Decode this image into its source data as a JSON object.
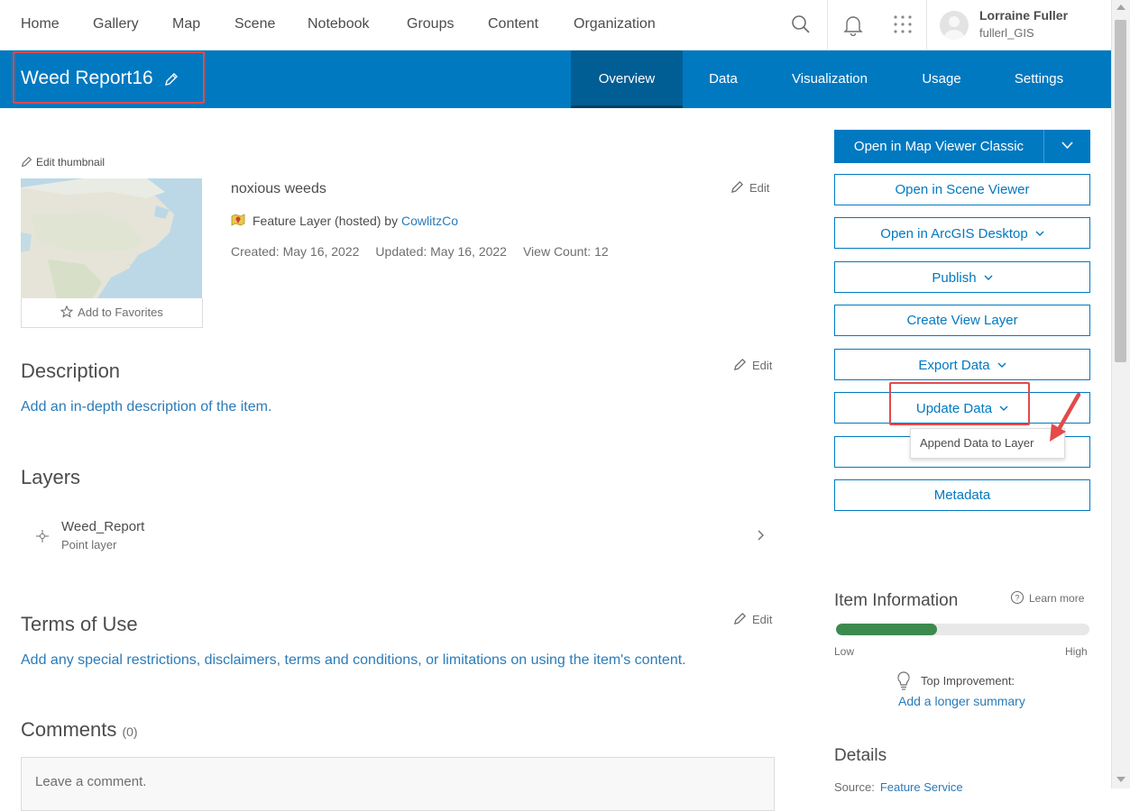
{
  "nav": {
    "items": [
      "Home",
      "Gallery",
      "Map",
      "Scene",
      "Notebook",
      "Groups",
      "Content",
      "Organization"
    ],
    "user_name": "Lorraine Fuller",
    "user_handle": "fullerl_GIS"
  },
  "header": {
    "title": "Weed Report16",
    "tabs": [
      "Overview",
      "Data",
      "Visualization",
      "Usage",
      "Settings"
    ],
    "active_tab": "Overview"
  },
  "overview": {
    "edit_thumbnail": "Edit thumbnail",
    "add_favorites": "Add to Favorites",
    "summary": "noxious weeds",
    "edit_label": "Edit",
    "type_prefix": "Feature Layer (hosted) by",
    "owner": "CowlitzCo",
    "created": "Created: May 16, 2022",
    "updated": "Updated: May 16, 2022",
    "views": "View Count: 12"
  },
  "description": {
    "heading": "Description",
    "link": "Add an in-depth description of the item."
  },
  "layers": {
    "heading": "Layers",
    "items": [
      {
        "name": "Weed_Report",
        "type": "Point layer"
      }
    ]
  },
  "terms": {
    "heading": "Terms of Use",
    "link": "Add any special restrictions, disclaimers, terms and conditions, or limitations on using the item's content."
  },
  "comments": {
    "heading": "Comments",
    "count": "(0)",
    "placeholder": "Leave a comment."
  },
  "actions": {
    "primary": "Open in Map Viewer Classic",
    "scene": "Open in Scene Viewer",
    "desktop": "Open in ArcGIS Desktop",
    "publish": "Publish",
    "view_layer": "Create View Layer",
    "export": "Export Data",
    "update": "Update Data",
    "append": "Append Data to Layer",
    "metadata": "Metadata"
  },
  "item_info": {
    "heading": "Item Information",
    "learn_more": "Learn more",
    "score_fraction": 0.4,
    "low": "Low",
    "high": "High",
    "top_improvement": "Top Improvement:",
    "suggestion": "Add a longer summary"
  },
  "details": {
    "heading": "Details",
    "source_label": "Source:",
    "source_value": "Feature Service"
  },
  "colors": {
    "brand_blue": "#0079c1",
    "highlight_red": "#e34a4a",
    "meter_green": "#3d8a4e",
    "link_blue": "#2b7bb8"
  }
}
